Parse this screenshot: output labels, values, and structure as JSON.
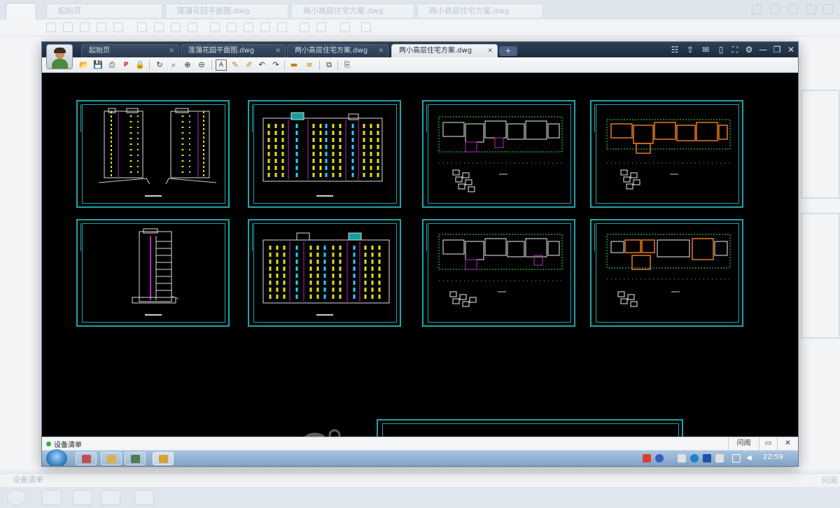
{
  "background": {
    "tabs": [
      "起始页",
      "莲蒲花园平面图.dwg",
      "两小高层住宅方案.dwg",
      "两小高层住宅方案.dwg"
    ],
    "status_text": "设备清单",
    "status_right": "问阅"
  },
  "window": {
    "tabs": [
      {
        "label": "起始页",
        "active": false
      },
      {
        "label": "莲蒲花园平面图.dwg",
        "active": false
      },
      {
        "label": "两小高层住宅方案.dwg",
        "active": false
      },
      {
        "label": "两小高层住宅方案.dwg",
        "active": true
      }
    ],
    "add_tab_label": "+",
    "title_icons": [
      "users-icon",
      "share-icon",
      "chat-icon",
      "phone-icon",
      "fullscreen-icon",
      "gear-icon"
    ],
    "window_controls": {
      "minimize": "—",
      "restore": "❐",
      "close": "✕"
    }
  },
  "toolbar": {
    "tools": [
      "open-icon",
      "save-icon",
      "print-icon",
      "pdf-icon",
      "lock-icon",
      "rotate-icon",
      "zoom-window-icon",
      "zoom-in-icon",
      "zoom-out-icon",
      "text-icon",
      "pen-icon",
      "marker-icon",
      "undo-icon",
      "redo-icon",
      "measure-icon",
      "layers-measure-icon",
      "layers-icon",
      "export-icon"
    ]
  },
  "drawings": [
    {
      "id": "elevation-side-pair",
      "kind": "side-elevations"
    },
    {
      "id": "elevation-front-1",
      "kind": "front-elevation"
    },
    {
      "id": "floorplan-1",
      "kind": "floorplan-green"
    },
    {
      "id": "floorplan-2",
      "kind": "floorplan-orange"
    },
    {
      "id": "elevation-side-single",
      "kind": "side-elevation"
    },
    {
      "id": "elevation-front-2",
      "kind": "front-elevation"
    },
    {
      "id": "floorplan-3",
      "kind": "floorplan-green"
    },
    {
      "id": "floorplan-4",
      "kind": "floorplan-orange"
    }
  ],
  "status": {
    "text": "设备清单",
    "right_label": "问阅",
    "chat_icon": "chat-icon",
    "close_icon": "close-icon"
  },
  "taskbar": {
    "clock": "22:59"
  }
}
